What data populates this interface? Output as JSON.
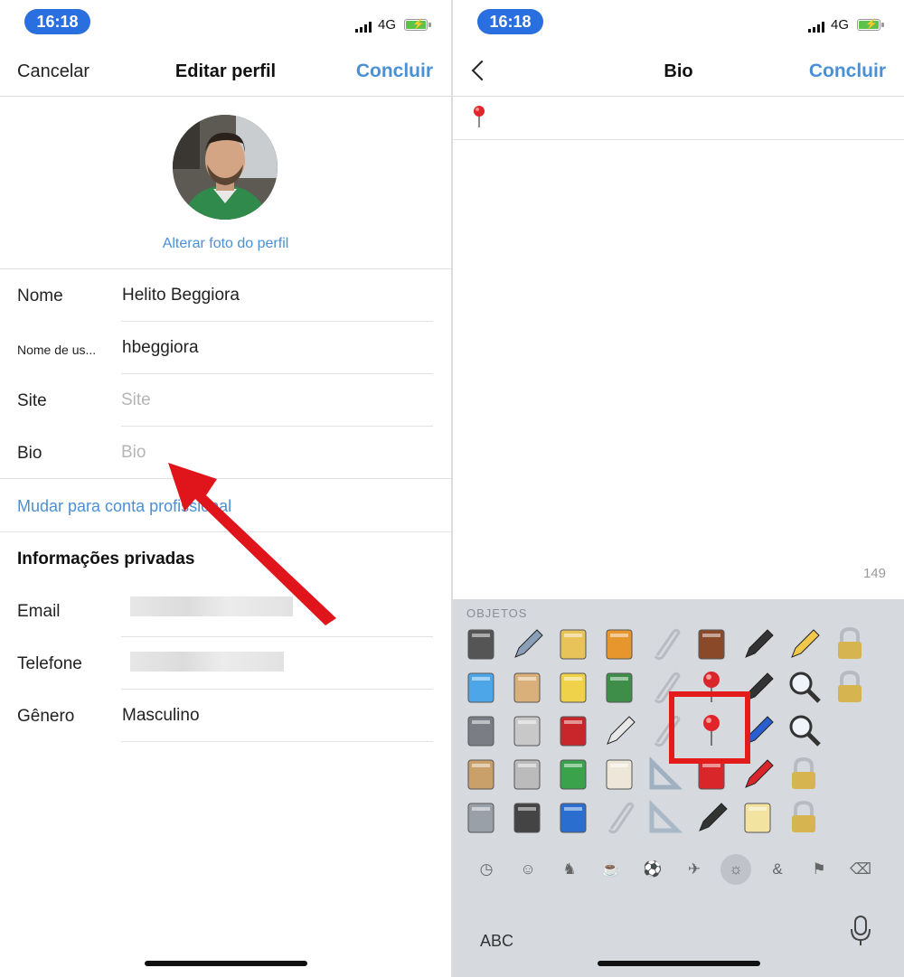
{
  "status_bar": {
    "time": "16:18",
    "network": "4G"
  },
  "edit_profile": {
    "nav": {
      "cancel_label": "Cancelar",
      "title": "Editar perfil",
      "done_label": "Concluir"
    },
    "change_photo_label": "Alterar foto do perfil",
    "fields": {
      "name": {
        "label": "Nome",
        "value": "Helito Beggiora"
      },
      "username": {
        "label": "Nome de us...",
        "value": "hbeggiora"
      },
      "site": {
        "label": "Site",
        "placeholder": "Site"
      },
      "bio": {
        "label": "Bio",
        "placeholder": "Bio"
      }
    },
    "switch_account_label": "Mudar para conta profissional",
    "private_section": {
      "title": "Informações privadas",
      "email_label": "Email",
      "phone_label": "Telefone",
      "gender_label": "Gênero",
      "gender_value": "Masculino"
    }
  },
  "bio_screen": {
    "nav": {
      "title": "Bio",
      "done_label": "Concluir"
    },
    "content_emoji": "pushpin-icon",
    "char_count": "149",
    "keyboard": {
      "category": "OBJETOS",
      "abc_label": "ABC",
      "emojis": [
        [
          "card-file-box",
          "open-folder",
          "envelope-notebook",
          "orange-notebook",
          "linked-paperclips",
          "abacus",
          "fountain-pen",
          "pencil",
          "lock"
        ],
        [
          "ballot-box",
          "card-index-dividers",
          "spiral-notepad",
          "books",
          "paperclip",
          "pushpin",
          "black-nib",
          "magnifying-glass-left",
          "lock-closed"
        ],
        [
          "file-cabinet",
          "newspaper",
          "red-book",
          "open-book",
          "paperclip-2",
          "round-pushpin",
          "blue-pen",
          "magnifying-glass-right",
          ""
        ],
        [
          "clipboard",
          "rolled-newspaper",
          "green-book",
          "label-tag",
          "triangular-ruler",
          "scissors",
          "crayon",
          "locked-with-pen",
          ""
        ],
        [
          "folder",
          "notebook",
          "blue-book",
          "safety-pin",
          "straight-ruler",
          "pen",
          "memo",
          "locked-with-key",
          ""
        ]
      ],
      "tabs": [
        "recent-icon",
        "smileys-icon",
        "animals-icon",
        "food-icon",
        "activity-icon",
        "travel-icon",
        "objects-icon",
        "symbols-icon",
        "flags-icon",
        "backspace-icon"
      ],
      "active_tab": "objects-icon"
    }
  },
  "colors": {
    "accent_blue": "#4a90d6",
    "time_pill": "#2a6fe0",
    "highlight_red": "#e31b1b",
    "arrow_red": "#e0141b"
  }
}
